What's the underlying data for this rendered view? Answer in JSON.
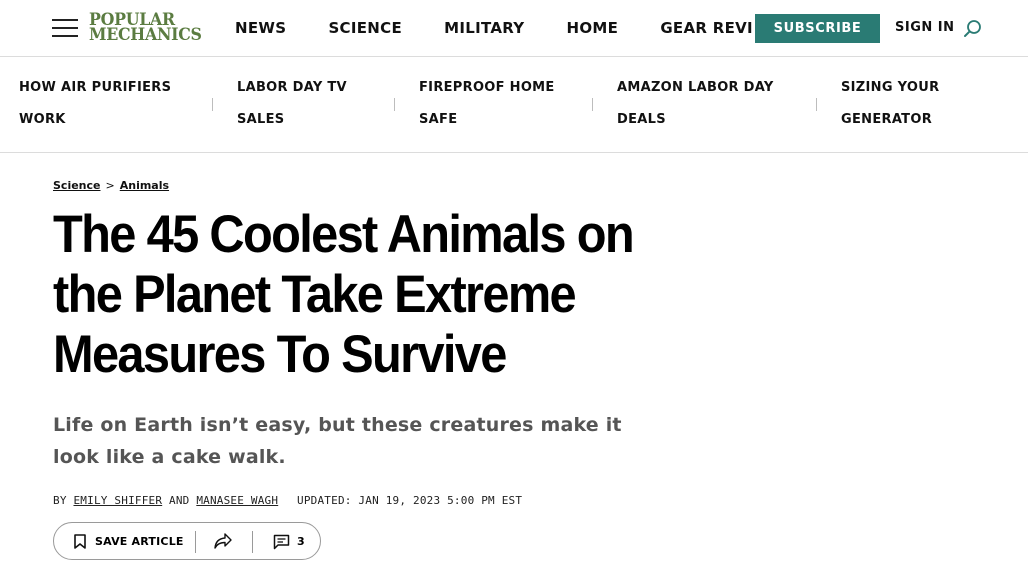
{
  "header": {
    "logo_line1": "POPULAR",
    "logo_line2": "MECHANICS",
    "nav": [
      "NEWS",
      "SCIENCE",
      "MILITARY",
      "HOME",
      "GEAR REVIEWS"
    ],
    "subscribe_label": "SUBSCRIBE",
    "signin_label": "SIGN IN"
  },
  "trending": [
    {
      "line1": "HOW AIR PURIFIERS",
      "line2": "WORK"
    },
    {
      "line1": "LABOR DAY TV",
      "line2": "SALES"
    },
    {
      "line1": "FIREPROOF HOME",
      "line2": "SAFE"
    },
    {
      "line1": "AMAZON LABOR DAY",
      "line2": "DEALS"
    },
    {
      "line1": "SIZING YOUR",
      "line2": "GENERATOR"
    }
  ],
  "breadcrumb": {
    "parent": "Science",
    "separator": ">",
    "current": "Animals"
  },
  "article": {
    "title": "The 45 Coolest Animals on the Planet Take Extreme Measures To Survive",
    "dek": "Life on Earth isn’t easy, but these creatures make it look like a cake walk.",
    "byline_prefix": "BY",
    "author1": "EMILY SHIFFER",
    "byline_and": "AND",
    "author2": "MANASEE WAGH",
    "updated": "UPDATED: JAN 19, 2023 5:00 PM EST"
  },
  "actions": {
    "save_label": "SAVE ARTICLE",
    "comment_count": "3"
  },
  "colors": {
    "brand_green": "#5b7c41",
    "subscribe_teal": "#2a7b74"
  },
  "icons": [
    "hamburger-menu-icon",
    "search-icon",
    "bookmark-icon",
    "share-icon",
    "comment-icon"
  ]
}
